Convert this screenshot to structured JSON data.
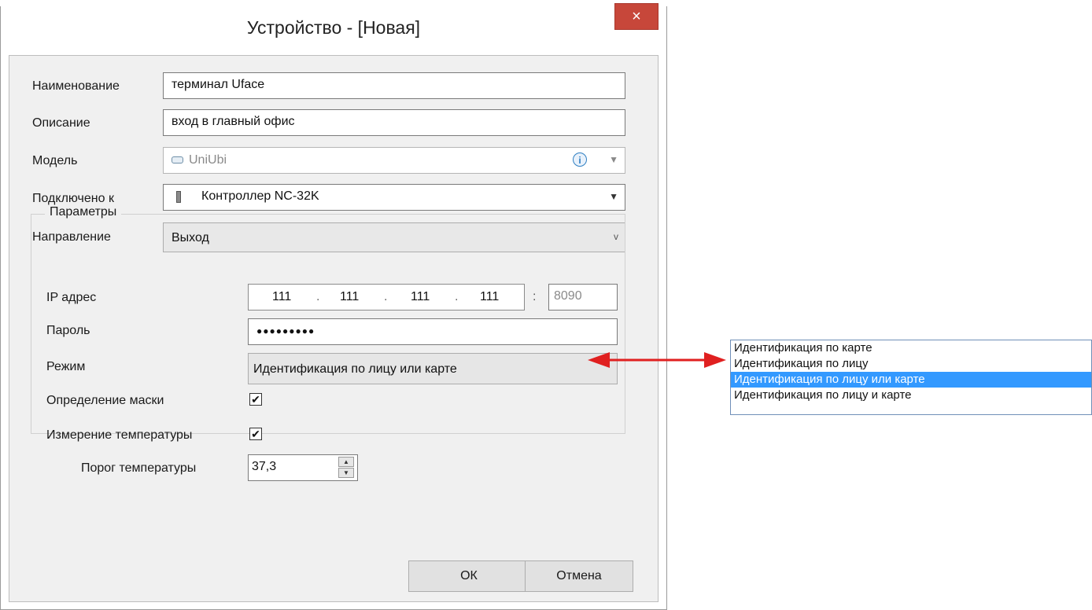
{
  "window": {
    "title": "Устройство -  [Новая]",
    "close_glyph": "×"
  },
  "form": {
    "name": {
      "label": "Наименование",
      "value": "терминал Uface"
    },
    "description": {
      "label": "Описание",
      "value": "вход в главный офис"
    },
    "model": {
      "label": "Модель",
      "value": "UniUbi",
      "icon": "device-icon",
      "info_glyph": "i"
    },
    "connected_to": {
      "label": "Подключено к",
      "value": "Контроллер NC-32K",
      "icon": "controller-door-icon"
    },
    "direction": {
      "label": "Направление",
      "value": "Выход"
    }
  },
  "params": {
    "title": "Параметры",
    "ip": {
      "label": "IP адрес",
      "octets": [
        "111",
        "111",
        "111",
        "111"
      ],
      "separator": ".",
      "port_separator": ":",
      "port": "8090"
    },
    "password": {
      "label": "Пароль",
      "masked": "●●●●●●●●●"
    },
    "mode": {
      "label": "Режим",
      "value": "Идентификация по лицу или карте"
    },
    "mask_detection": {
      "label": "Определение маски",
      "checked": true
    },
    "temperature": {
      "label": "Измерение температуры",
      "checked": true
    },
    "threshold": {
      "label": "Порог температуры",
      "value": "37,3"
    }
  },
  "buttons": {
    "ok": "ОК",
    "cancel": "Отмена"
  },
  "mode_options": [
    "Идентификация по карте",
    "Идентификация по лицу",
    "Идентификация по лицу или карте",
    "Идентификация по лицу и карте"
  ],
  "selected_mode_index": 2,
  "colors": {
    "close": "#c7473a",
    "arrow": "#e02020",
    "selection": "#3399ff"
  }
}
